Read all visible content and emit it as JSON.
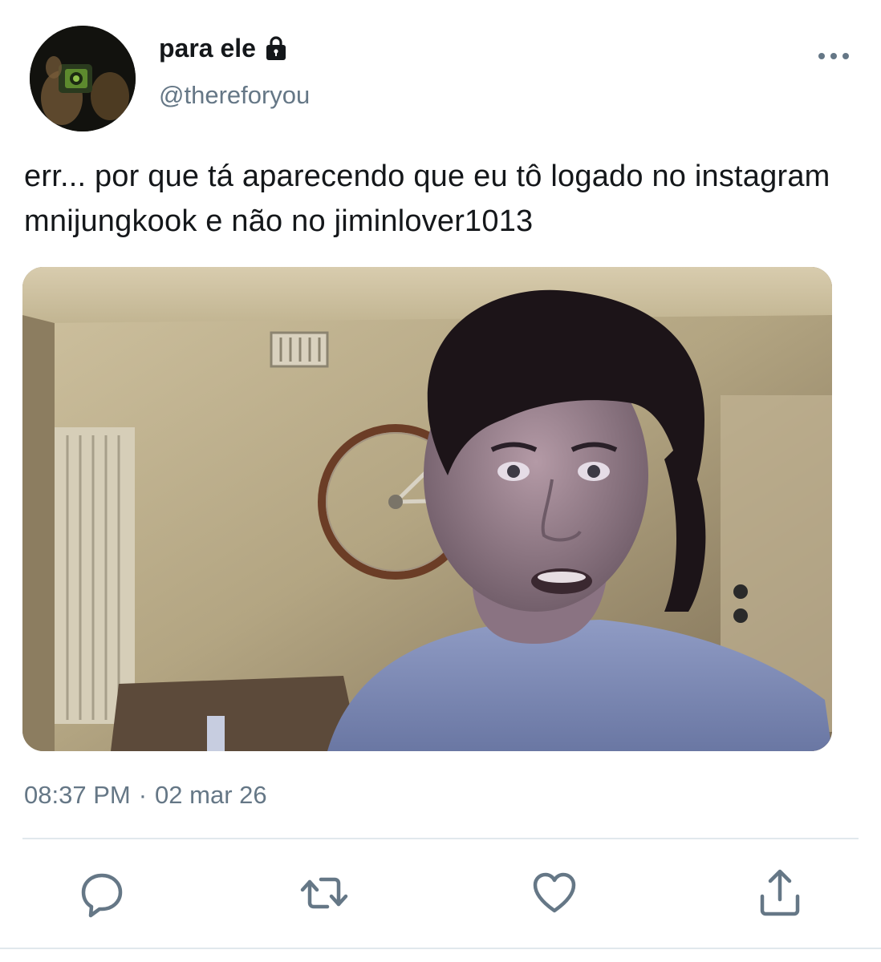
{
  "user": {
    "display_name": "para ele",
    "handle": "@thereforyou",
    "protected_icon": "lock-icon",
    "avatar_icon": "avatar"
  },
  "tweet": {
    "text": "err... por que tá aparecendo que eu tô logado no instagram mnijungkook e não no jiminlover1013",
    "time": "08:37 PM",
    "separator": "·",
    "date": "02 mar 26"
  },
  "actions": {
    "reply_icon": "reply-icon",
    "retweet_icon": "retweet-icon",
    "like_icon": "like-icon",
    "share_icon": "share-icon",
    "more_icon": "more-icon"
  },
  "colors": {
    "primary_text": "#14171a",
    "secondary_text": "#657786",
    "divider": "#e1e8ed",
    "icon": "#657786"
  }
}
